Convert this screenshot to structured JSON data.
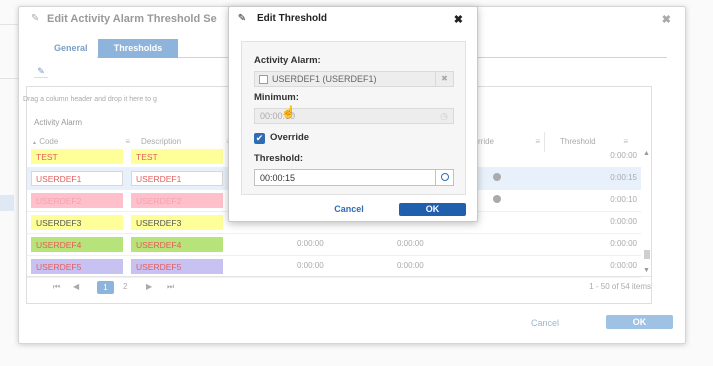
{
  "outer_dialog": {
    "title": "Edit Activity Alarm Threshold Se",
    "tabs": [
      {
        "label": "General"
      },
      {
        "label": "Thresholds"
      }
    ],
    "grid": {
      "group_hint": "Drag a column header and drop it here to g",
      "column_group": "Activity Alarm",
      "headers": {
        "code": "Code",
        "description": "Description",
        "override": "rride",
        "threshold": "Threshold"
      },
      "rows": [
        {
          "code": "TEST",
          "description": "TEST",
          "v1": "",
          "v2": "",
          "threshold": "0:00:00",
          "bg": "#ffff99",
          "fg": "#e06060",
          "selected": false,
          "icon": false
        },
        {
          "code": "USERDEF1",
          "description": "USERDEF1",
          "v1": "",
          "v2": "",
          "threshold": "0:00:15",
          "bg": "#ffffff",
          "fg": "#e06060",
          "selected": true,
          "icon": true
        },
        {
          "code": "USERDEF2",
          "description": "USERDEF2",
          "v1": "",
          "v2": "",
          "threshold": "0:00:10",
          "bg": "#ffc0cb",
          "fg": "#f1a3b0",
          "selected": false,
          "icon": true
        },
        {
          "code": "USERDEF3",
          "description": "USERDEF3",
          "v1": "",
          "v2": "",
          "threshold": "0:00:00",
          "bg": "#ffff99",
          "fg": "#555555",
          "selected": false,
          "icon": false
        },
        {
          "code": "USERDEF4",
          "description": "USERDEF4",
          "v1": "0:00:00",
          "v2": "0:00:00",
          "threshold": "0:00:00",
          "bg": "#b6e37a",
          "fg": "#e85a5a",
          "selected": false,
          "icon": false
        },
        {
          "code": "USERDEF5",
          "description": "USERDEF5",
          "v1": "0:00:00",
          "v2": "0:00:00",
          "threshold": "0:00:00",
          "bg": "#c7c2f2",
          "fg": "#e85a5a",
          "selected": false,
          "icon": false
        }
      ]
    },
    "pager": {
      "first": "⏮",
      "prev": "◀",
      "page1": "1",
      "page2": "2",
      "next": "▶",
      "last": "⏭",
      "info": "1 - 50 of 54 items"
    },
    "cancel_label": "Cancel",
    "ok_label": "OK"
  },
  "inner_dialog": {
    "title": "Edit Threshold",
    "activity_alarm_label": "Activity Alarm:",
    "activity_alarm_value": "USERDEF1 (USERDEF1)",
    "minimum_label": "Minimum:",
    "minimum_value": "00:00:00",
    "override_label": "Override",
    "override_checked": true,
    "threshold_label": "Threshold:",
    "threshold_value": "00:00:15",
    "cancel_label": "Cancel",
    "ok_label": "OK"
  },
  "icons": {
    "pencil": "✎",
    "close": "✖",
    "check": "✔",
    "clock": "◷",
    "hand_cursor": "☝",
    "sort_up": "▲",
    "column_menu": "≡",
    "scroll_up": "▲",
    "scroll_down": "▼"
  },
  "colors": {
    "accent": "#2e6db4",
    "tab_active": "#8fb4dc",
    "ok_button": "#1f5fae"
  }
}
